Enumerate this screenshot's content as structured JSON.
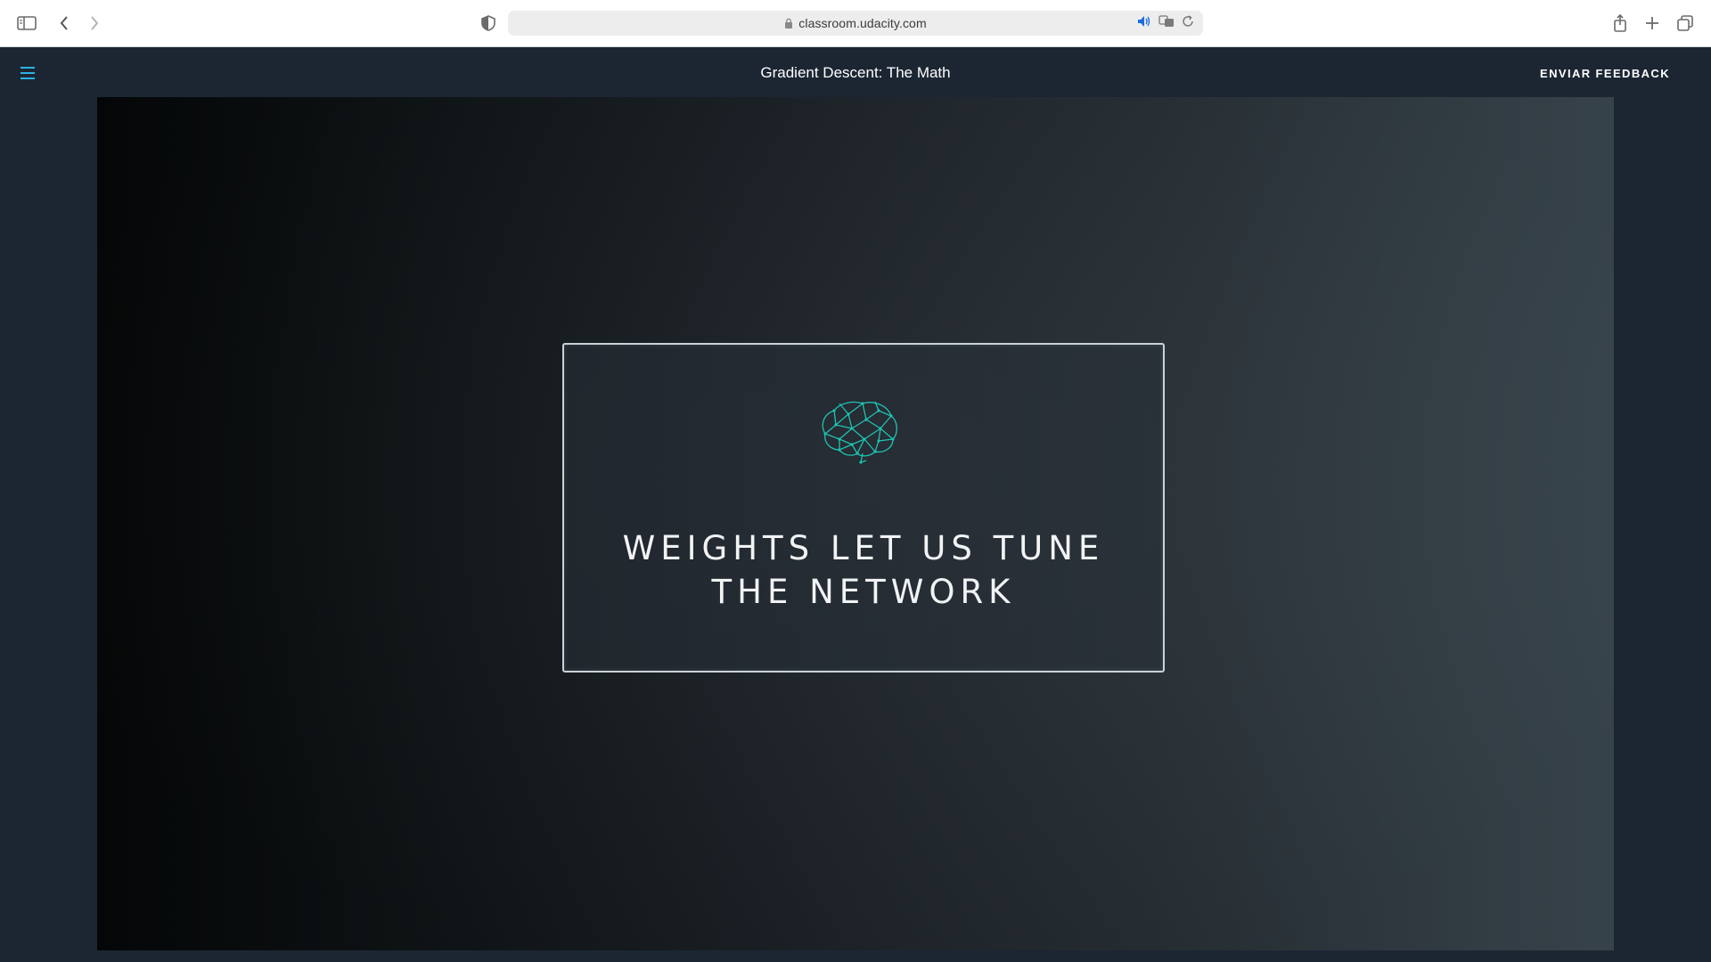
{
  "browser": {
    "url": "classroom.udacity.com"
  },
  "header": {
    "title": "Gradient Descent: The Math",
    "feedback_label": "ENVIAR FEEDBACK"
  },
  "video": {
    "slide_lines": [
      "WEIGHTS LET US TUNE",
      "THE NETWORK"
    ]
  },
  "colors": {
    "header_bg": "#1c2633",
    "accent": "#2bb3e4",
    "brain": "#1fc2b0"
  }
}
